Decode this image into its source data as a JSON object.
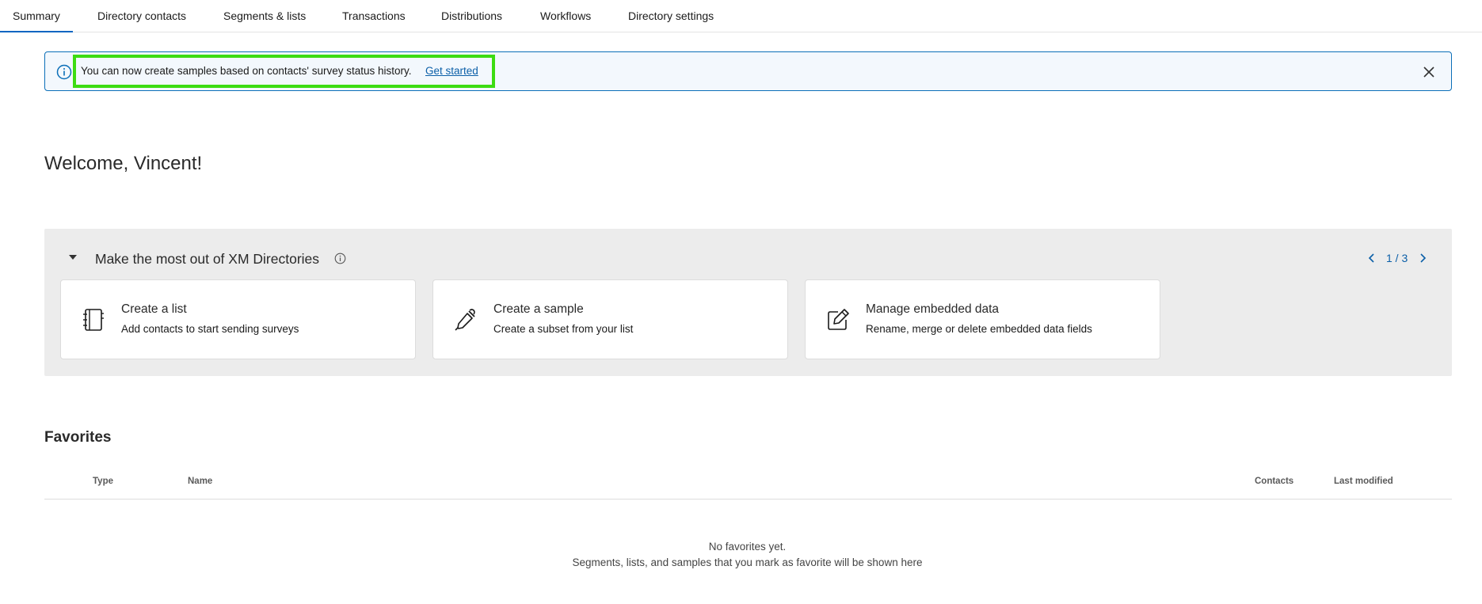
{
  "tabs": [
    {
      "label": "Summary"
    },
    {
      "label": "Directory contacts"
    },
    {
      "label": "Segments & lists"
    },
    {
      "label": "Transactions"
    },
    {
      "label": "Distributions"
    },
    {
      "label": "Workflows"
    },
    {
      "label": "Directory settings"
    }
  ],
  "banner": {
    "icon": "info-circle-icon",
    "text": "You can now create samples based on contacts' survey status history.",
    "link_label": "Get started",
    "close_icon": "close-icon",
    "highlight_color": "#3ddc12"
  },
  "welcome": "Welcome, Vincent!",
  "panel": {
    "title": "Make the most out of XM Directories",
    "pager": "1 / 3",
    "cards": [
      {
        "icon": "notebook-icon",
        "title": "Create a list",
        "subtitle": "Add contacts to start sending surveys"
      },
      {
        "icon": "eyedropper-icon",
        "title": "Create a sample",
        "subtitle": "Create a subset from your list"
      },
      {
        "icon": "edit-icon",
        "title": "Manage embedded data",
        "subtitle": "Rename, merge or delete embedded data fields"
      }
    ]
  },
  "favorites": {
    "title": "Favorites",
    "columns": [
      "Type",
      "Name",
      "Contacts",
      "Last modified"
    ],
    "empty_title": "No favorites yet.",
    "empty_message": "Segments, lists, and samples that you mark as favorite will be shown here"
  },
  "colors": {
    "accent": "#0a66c2",
    "link": "#0b5fa8",
    "banner_bg": "#f3f8fd",
    "panel_bg": "#ececec"
  }
}
